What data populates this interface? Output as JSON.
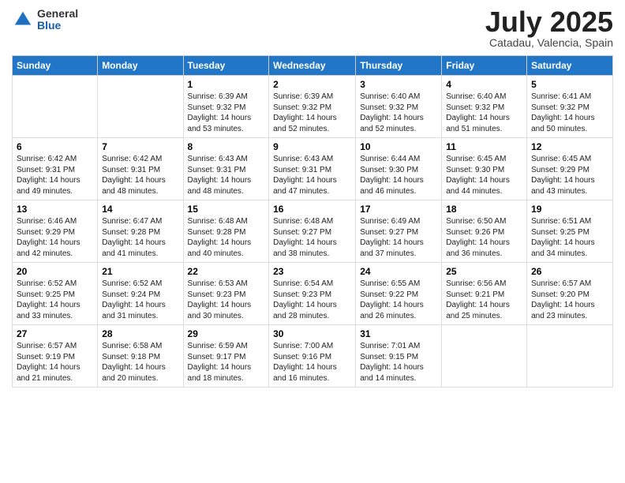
{
  "header": {
    "logo_general": "General",
    "logo_blue": "Blue",
    "month_title": "July 2025",
    "location": "Catadau, Valencia, Spain"
  },
  "days_of_week": [
    "Sunday",
    "Monday",
    "Tuesday",
    "Wednesday",
    "Thursday",
    "Friday",
    "Saturday"
  ],
  "weeks": [
    [
      {
        "day": "",
        "sunrise": "",
        "sunset": "",
        "daylight": ""
      },
      {
        "day": "",
        "sunrise": "",
        "sunset": "",
        "daylight": ""
      },
      {
        "day": "1",
        "sunrise": "Sunrise: 6:39 AM",
        "sunset": "Sunset: 9:32 PM",
        "daylight": "Daylight: 14 hours and 53 minutes."
      },
      {
        "day": "2",
        "sunrise": "Sunrise: 6:39 AM",
        "sunset": "Sunset: 9:32 PM",
        "daylight": "Daylight: 14 hours and 52 minutes."
      },
      {
        "day": "3",
        "sunrise": "Sunrise: 6:40 AM",
        "sunset": "Sunset: 9:32 PM",
        "daylight": "Daylight: 14 hours and 52 minutes."
      },
      {
        "day": "4",
        "sunrise": "Sunrise: 6:40 AM",
        "sunset": "Sunset: 9:32 PM",
        "daylight": "Daylight: 14 hours and 51 minutes."
      },
      {
        "day": "5",
        "sunrise": "Sunrise: 6:41 AM",
        "sunset": "Sunset: 9:32 PM",
        "daylight": "Daylight: 14 hours and 50 minutes."
      }
    ],
    [
      {
        "day": "6",
        "sunrise": "Sunrise: 6:42 AM",
        "sunset": "Sunset: 9:31 PM",
        "daylight": "Daylight: 14 hours and 49 minutes."
      },
      {
        "day": "7",
        "sunrise": "Sunrise: 6:42 AM",
        "sunset": "Sunset: 9:31 PM",
        "daylight": "Daylight: 14 hours and 48 minutes."
      },
      {
        "day": "8",
        "sunrise": "Sunrise: 6:43 AM",
        "sunset": "Sunset: 9:31 PM",
        "daylight": "Daylight: 14 hours and 48 minutes."
      },
      {
        "day": "9",
        "sunrise": "Sunrise: 6:43 AM",
        "sunset": "Sunset: 9:31 PM",
        "daylight": "Daylight: 14 hours and 47 minutes."
      },
      {
        "day": "10",
        "sunrise": "Sunrise: 6:44 AM",
        "sunset": "Sunset: 9:30 PM",
        "daylight": "Daylight: 14 hours and 46 minutes."
      },
      {
        "day": "11",
        "sunrise": "Sunrise: 6:45 AM",
        "sunset": "Sunset: 9:30 PM",
        "daylight": "Daylight: 14 hours and 44 minutes."
      },
      {
        "day": "12",
        "sunrise": "Sunrise: 6:45 AM",
        "sunset": "Sunset: 9:29 PM",
        "daylight": "Daylight: 14 hours and 43 minutes."
      }
    ],
    [
      {
        "day": "13",
        "sunrise": "Sunrise: 6:46 AM",
        "sunset": "Sunset: 9:29 PM",
        "daylight": "Daylight: 14 hours and 42 minutes."
      },
      {
        "day": "14",
        "sunrise": "Sunrise: 6:47 AM",
        "sunset": "Sunset: 9:28 PM",
        "daylight": "Daylight: 14 hours and 41 minutes."
      },
      {
        "day": "15",
        "sunrise": "Sunrise: 6:48 AM",
        "sunset": "Sunset: 9:28 PM",
        "daylight": "Daylight: 14 hours and 40 minutes."
      },
      {
        "day": "16",
        "sunrise": "Sunrise: 6:48 AM",
        "sunset": "Sunset: 9:27 PM",
        "daylight": "Daylight: 14 hours and 38 minutes."
      },
      {
        "day": "17",
        "sunrise": "Sunrise: 6:49 AM",
        "sunset": "Sunset: 9:27 PM",
        "daylight": "Daylight: 14 hours and 37 minutes."
      },
      {
        "day": "18",
        "sunrise": "Sunrise: 6:50 AM",
        "sunset": "Sunset: 9:26 PM",
        "daylight": "Daylight: 14 hours and 36 minutes."
      },
      {
        "day": "19",
        "sunrise": "Sunrise: 6:51 AM",
        "sunset": "Sunset: 9:25 PM",
        "daylight": "Daylight: 14 hours and 34 minutes."
      }
    ],
    [
      {
        "day": "20",
        "sunrise": "Sunrise: 6:52 AM",
        "sunset": "Sunset: 9:25 PM",
        "daylight": "Daylight: 14 hours and 33 minutes."
      },
      {
        "day": "21",
        "sunrise": "Sunrise: 6:52 AM",
        "sunset": "Sunset: 9:24 PM",
        "daylight": "Daylight: 14 hours and 31 minutes."
      },
      {
        "day": "22",
        "sunrise": "Sunrise: 6:53 AM",
        "sunset": "Sunset: 9:23 PM",
        "daylight": "Daylight: 14 hours and 30 minutes."
      },
      {
        "day": "23",
        "sunrise": "Sunrise: 6:54 AM",
        "sunset": "Sunset: 9:23 PM",
        "daylight": "Daylight: 14 hours and 28 minutes."
      },
      {
        "day": "24",
        "sunrise": "Sunrise: 6:55 AM",
        "sunset": "Sunset: 9:22 PM",
        "daylight": "Daylight: 14 hours and 26 minutes."
      },
      {
        "day": "25",
        "sunrise": "Sunrise: 6:56 AM",
        "sunset": "Sunset: 9:21 PM",
        "daylight": "Daylight: 14 hours and 25 minutes."
      },
      {
        "day": "26",
        "sunrise": "Sunrise: 6:57 AM",
        "sunset": "Sunset: 9:20 PM",
        "daylight": "Daylight: 14 hours and 23 minutes."
      }
    ],
    [
      {
        "day": "27",
        "sunrise": "Sunrise: 6:57 AM",
        "sunset": "Sunset: 9:19 PM",
        "daylight": "Daylight: 14 hours and 21 minutes."
      },
      {
        "day": "28",
        "sunrise": "Sunrise: 6:58 AM",
        "sunset": "Sunset: 9:18 PM",
        "daylight": "Daylight: 14 hours and 20 minutes."
      },
      {
        "day": "29",
        "sunrise": "Sunrise: 6:59 AM",
        "sunset": "Sunset: 9:17 PM",
        "daylight": "Daylight: 14 hours and 18 minutes."
      },
      {
        "day": "30",
        "sunrise": "Sunrise: 7:00 AM",
        "sunset": "Sunset: 9:16 PM",
        "daylight": "Daylight: 14 hours and 16 minutes."
      },
      {
        "day": "31",
        "sunrise": "Sunrise: 7:01 AM",
        "sunset": "Sunset: 9:15 PM",
        "daylight": "Daylight: 14 hours and 14 minutes."
      },
      {
        "day": "",
        "sunrise": "",
        "sunset": "",
        "daylight": ""
      },
      {
        "day": "",
        "sunrise": "",
        "sunset": "",
        "daylight": ""
      }
    ]
  ]
}
